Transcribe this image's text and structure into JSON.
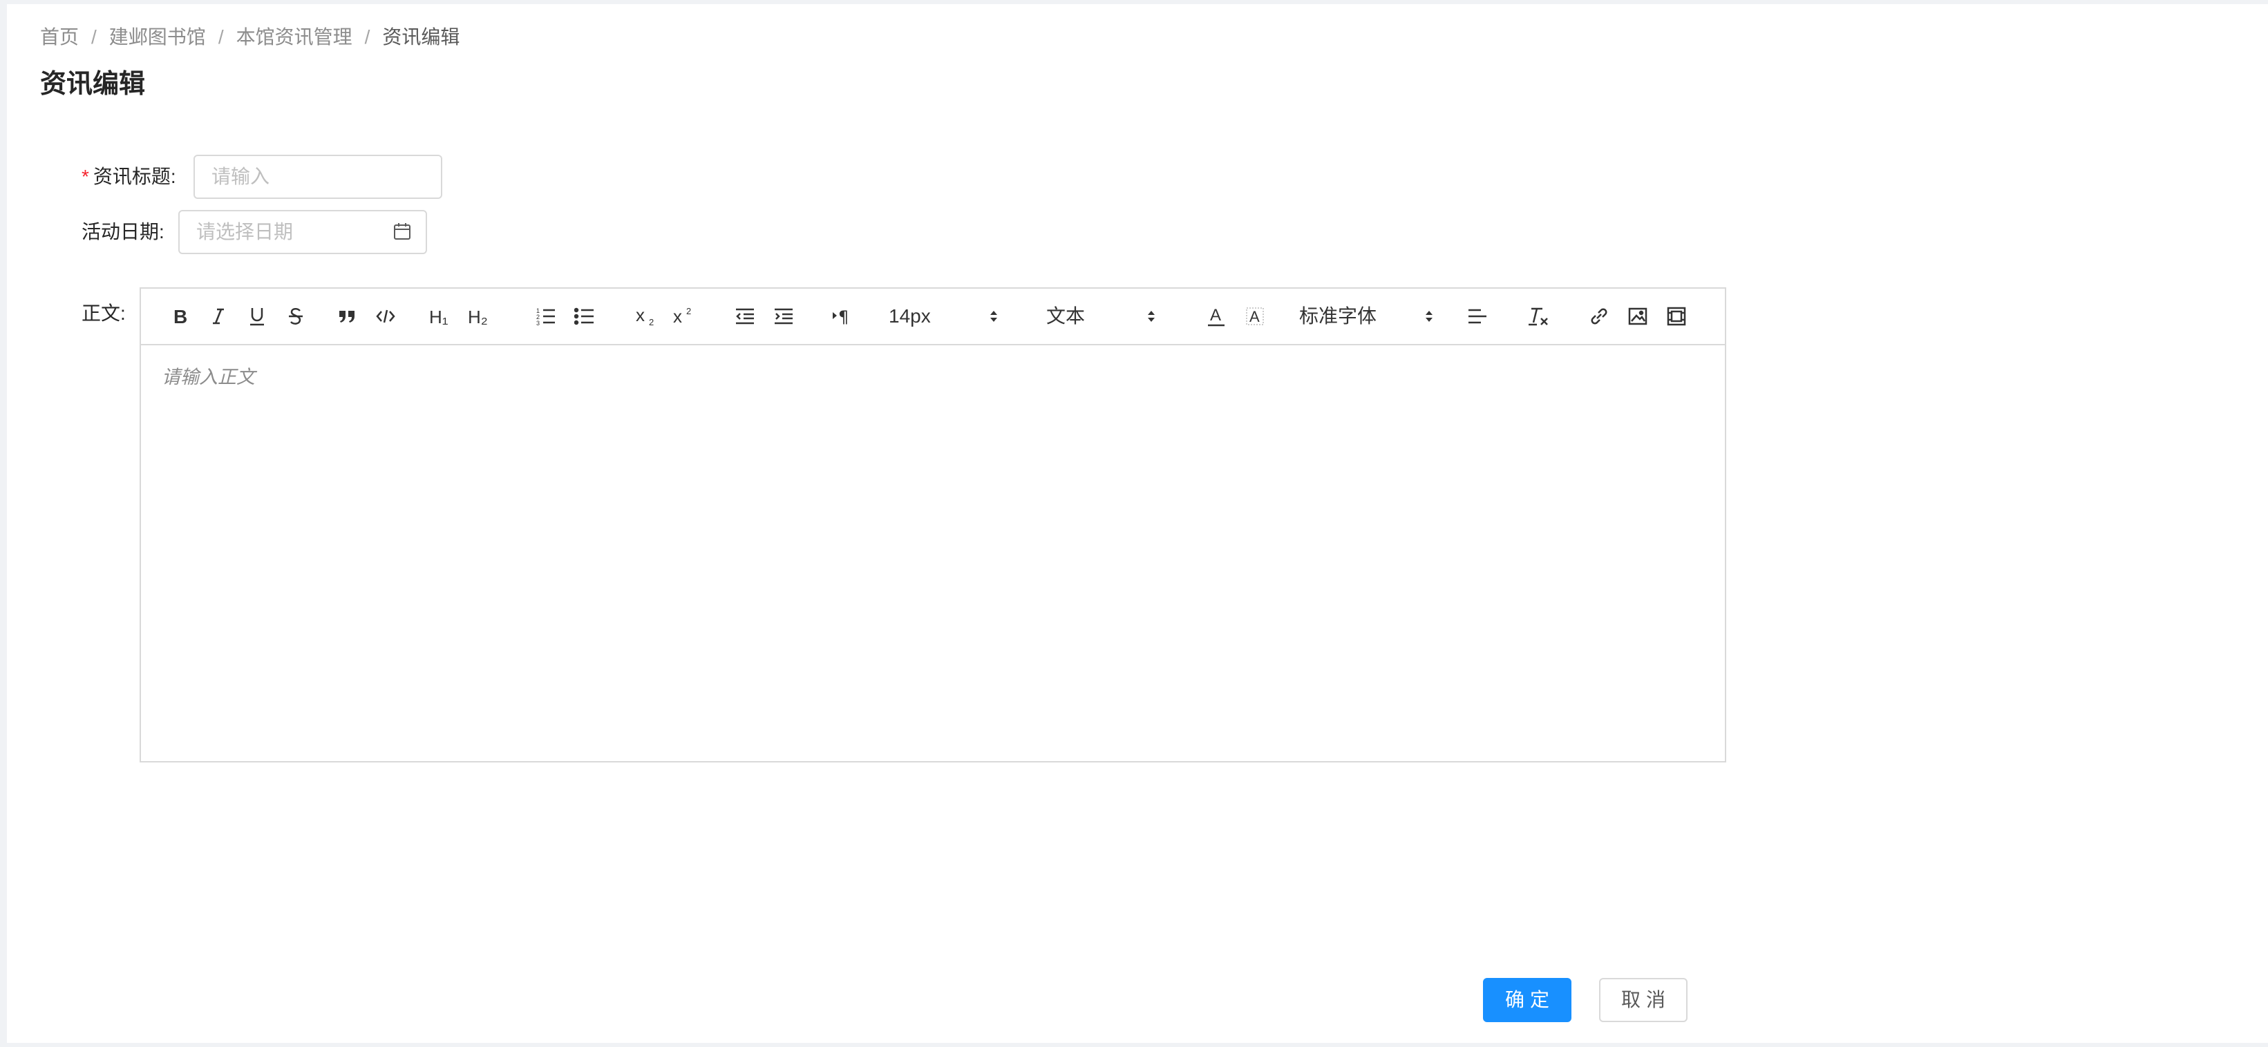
{
  "breadcrumb": {
    "items": [
      "首页",
      "建邺图书馆",
      "本馆资讯管理",
      "资讯编辑"
    ],
    "separator": "/"
  },
  "page_title": "资讯编辑",
  "form": {
    "title_label": "资讯标题:",
    "title_required_mark": "*",
    "title_placeholder": "请输入",
    "date_label": "活动日期:",
    "date_placeholder": "请选择日期",
    "body_label": "正文:"
  },
  "editor": {
    "placeholder": "请输入正文",
    "font_size": "14px",
    "header_picker": "文本",
    "font_family": "标准字体"
  },
  "buttons": {
    "confirm": "确定",
    "cancel": "取消"
  },
  "colors": {
    "primary": "#1890ff",
    "required": "#f5222d",
    "border": "#d9d9d9"
  }
}
